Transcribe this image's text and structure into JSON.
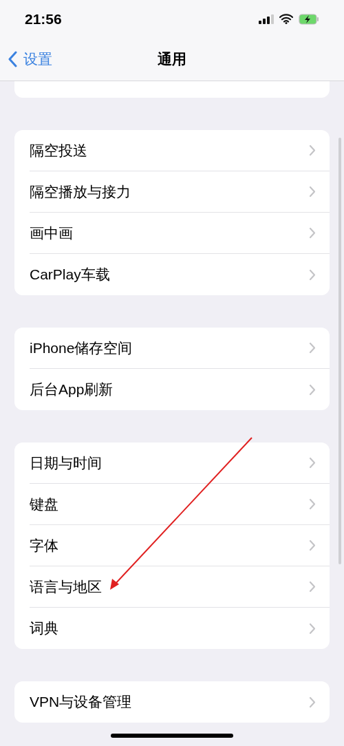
{
  "status_bar": {
    "time": "21:56"
  },
  "nav_bar": {
    "back": "设置",
    "title": "通用"
  },
  "groups": [
    {
      "items": [
        "隔空投送",
        "隔空播放与接力",
        "画中画",
        "CarPlay车载"
      ]
    },
    {
      "items": [
        "iPhone储存空间",
        "后台App刷新"
      ]
    },
    {
      "items": [
        "日期与时间",
        "键盘",
        "字体",
        "语言与地区",
        "词典"
      ]
    },
    {
      "items": [
        "VPN与设备管理"
      ]
    }
  ]
}
